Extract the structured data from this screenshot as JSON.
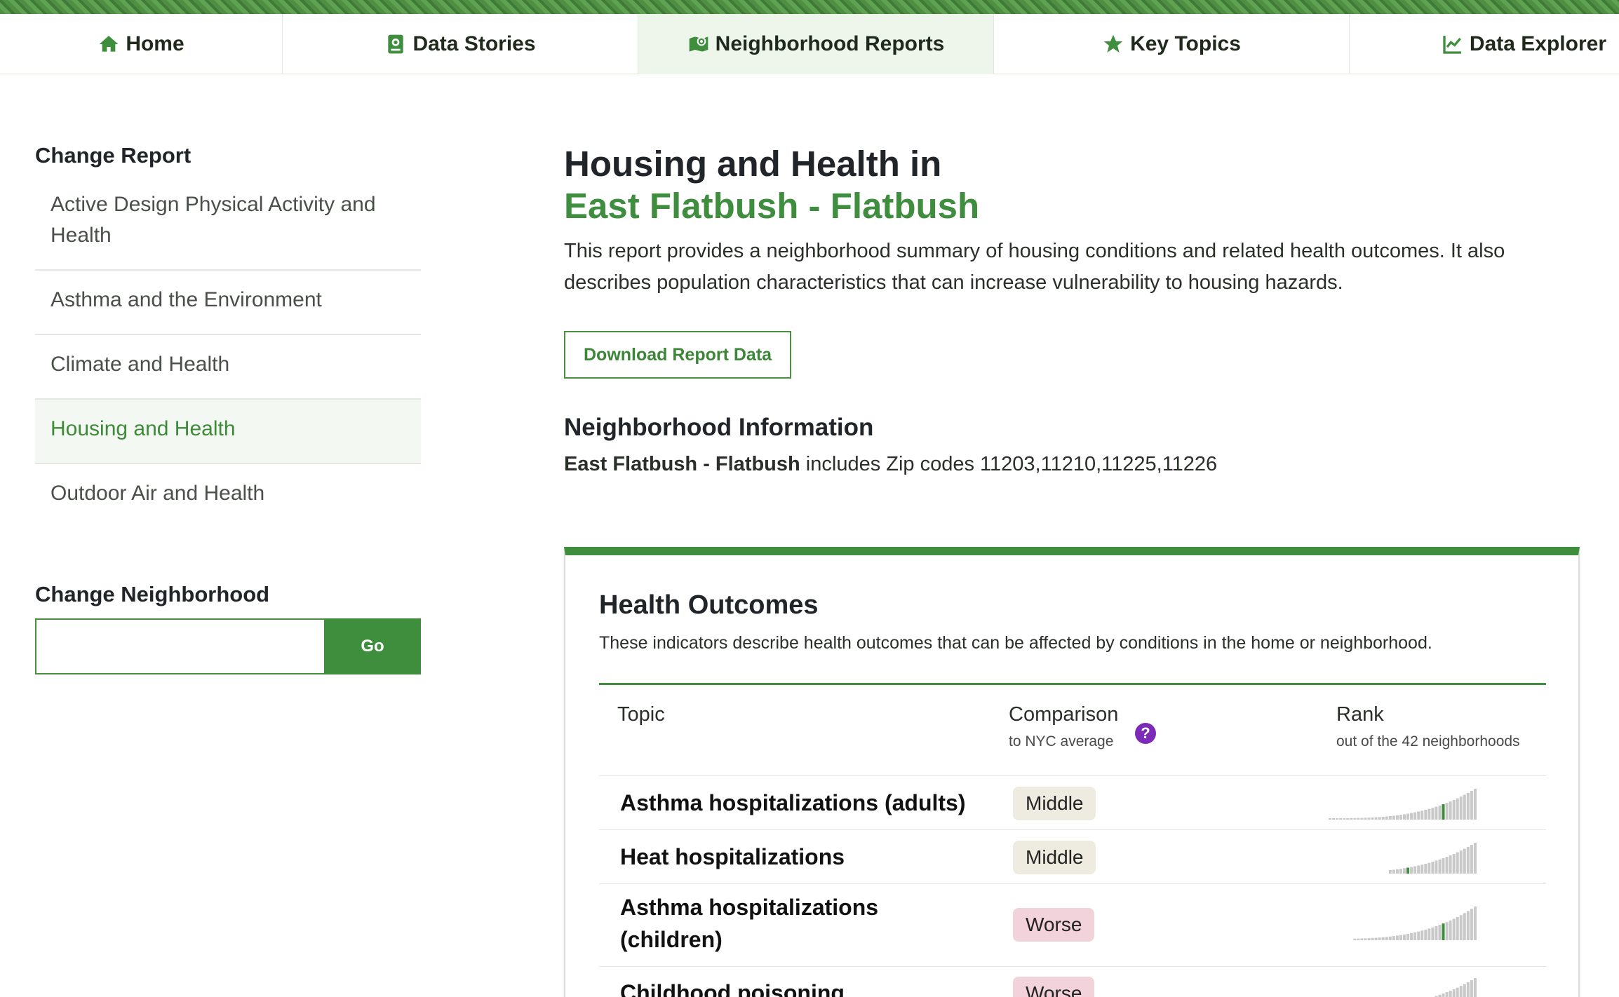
{
  "nav": {
    "home": "Home",
    "stories": "Data Stories",
    "reports": "Neighborhood Reports",
    "topics": "Key Topics",
    "explorer": "Data Explorer"
  },
  "sidebar": {
    "change_report": "Change Report",
    "reports": [
      "Active Design Physical Activity and Health",
      "Asthma and the Environment",
      "Climate and Health",
      "Housing and Health",
      "Outdoor Air and Health"
    ],
    "change_neighborhood": "Change Neighborhood",
    "search_value": "",
    "go_label": "Go"
  },
  "main": {
    "title": "Housing and Health in",
    "neighborhood": "East Flatbush - Flatbush",
    "intro": "This report provides a neighborhood summary of housing conditions and related health outcomes. It also describes population characteristics that can increase vulnerability to housing hazards.",
    "download_label": "Download Report Data",
    "ni_heading": "Neighborhood Information",
    "ni_name": "East Flatbush - Flatbush",
    "ni_text": " includes Zip codes 11203,11210,11225,11226"
  },
  "card": {
    "title": "Health Outcomes",
    "desc": "These indicators describe health outcomes that can be affected by conditions in the home or neighborhood.",
    "col_topic": "Topic",
    "col_comparison": "Comparison",
    "col_comparison_sub": "to NYC average",
    "help": "?",
    "col_rank": "Rank",
    "col_rank_sub": "out of the 42 neighborhoods",
    "rows": [
      {
        "topic": "Asthma hospitalizations (adults)",
        "comparison": "Middle"
      },
      {
        "topic": "Heat hospitalizations",
        "comparison": "Middle"
      },
      {
        "topic": "Asthma hospitalizations (children)",
        "comparison": "Worse"
      },
      {
        "topic": "Childhood poisoning",
        "comparison": "Worse"
      }
    ]
  },
  "colors": {
    "brand_green": "#3e8e3e",
    "help_purple": "#7d2ab8",
    "middle_badge": "#eeece0",
    "worse_badge": "#f2d3dc"
  }
}
